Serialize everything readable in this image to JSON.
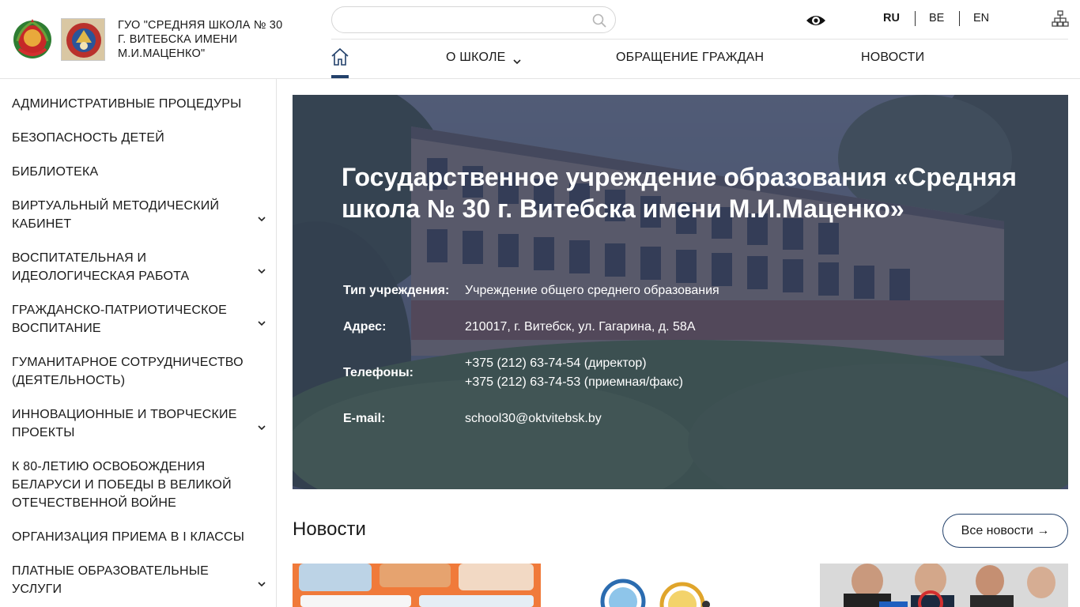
{
  "header": {
    "school_name": "ГУО \"СРЕДНЯЯ ШКОЛА № 30 Г. ВИТЕБСКА ИМЕНИ М.И.МАЦЕНКО\"",
    "search": {
      "placeholder": ""
    },
    "languages": [
      {
        "code": "RU",
        "active": true
      },
      {
        "code": "BE",
        "active": false
      },
      {
        "code": "EN",
        "active": false
      }
    ],
    "icons": [
      "emblem-icon",
      "crest-icon",
      "search-icon",
      "eye-icon",
      "sitemap-icon",
      "home-icon"
    ]
  },
  "nav": {
    "items": [
      {
        "label": "О ШКОЛЕ",
        "has_dropdown": true
      },
      {
        "label": "ОБРАЩЕНИЕ ГРАЖДАН",
        "has_dropdown": false
      },
      {
        "label": "НОВОСТИ",
        "has_dropdown": false
      }
    ]
  },
  "sidebar": {
    "items": [
      {
        "label": "АДМИНИСТРАТИВНЫЕ ПРОЦЕДУРЫ",
        "has_submenu": false
      },
      {
        "label": "БЕЗОПАСНОСТЬ ДЕТЕЙ",
        "has_submenu": false
      },
      {
        "label": "БИБЛИОТЕКА",
        "has_submenu": false
      },
      {
        "label": "ВИРТУАЛЬНЫЙ МЕТОДИЧЕСКИЙ КАБИНЕТ",
        "has_submenu": true
      },
      {
        "label": "ВОСПИТАТЕЛЬНАЯ И ИДЕОЛОГИЧЕСКАЯ РАБОТА",
        "has_submenu": true
      },
      {
        "label": "ГРАЖДАНСКО-ПАТРИОТИЧЕСКОЕ ВОСПИТАНИЕ",
        "has_submenu": true
      },
      {
        "label": "ГУМАНИТАРНОЕ СОТРУДНИЧЕСТВО (ДЕЯТЕЛЬНОСТЬ)",
        "has_submenu": false
      },
      {
        "label": "ИННОВАЦИОННЫЕ И ТВОРЧЕСКИЕ ПРОЕКТЫ",
        "has_submenu": true
      },
      {
        "label": "К 80-ЛЕТИЮ ОСВОБОЖДЕНИЯ БЕЛАРУСИ И ПОБЕДЫ В ВЕЛИКОЙ ОТЕЧЕСТВЕННОЙ ВОЙНЕ",
        "has_submenu": false
      },
      {
        "label": "ОРГАНИЗАЦИЯ ПРИЕМА В I КЛАССЫ",
        "has_submenu": false
      },
      {
        "label": "ПЛАТНЫЕ ОБРАЗОВАТЕЛЬНЫЕ УСЛУГИ",
        "has_submenu": true
      }
    ]
  },
  "hero": {
    "title": "Государственное учреждение образования «Средняя школа № 30 г. Витебска имени М.И.Маценко»",
    "info": [
      {
        "label": "Тип учреждения:",
        "lines": [
          "Учреждение общего среднего образования"
        ]
      },
      {
        "label": "Адрес:",
        "lines": [
          "210017, г. Витебск, ул. Гагарина, д. 58А"
        ]
      },
      {
        "label": "Телефоны:",
        "lines": [
          "+375 (212) 63-74-54 (директор)",
          "+375 (212) 63-74-53 (приемная/факс)"
        ]
      },
      {
        "label": "E-mail:",
        "lines": [
          "school30@oktvitebsk.by"
        ]
      }
    ]
  },
  "news": {
    "heading": "Новости",
    "all_news_label": "Все новости →"
  },
  "colors": {
    "accent": "#23416b",
    "hero_overlay": "#2f3b5c",
    "text": "#1a1a1a",
    "border": "#e3e3e3"
  }
}
